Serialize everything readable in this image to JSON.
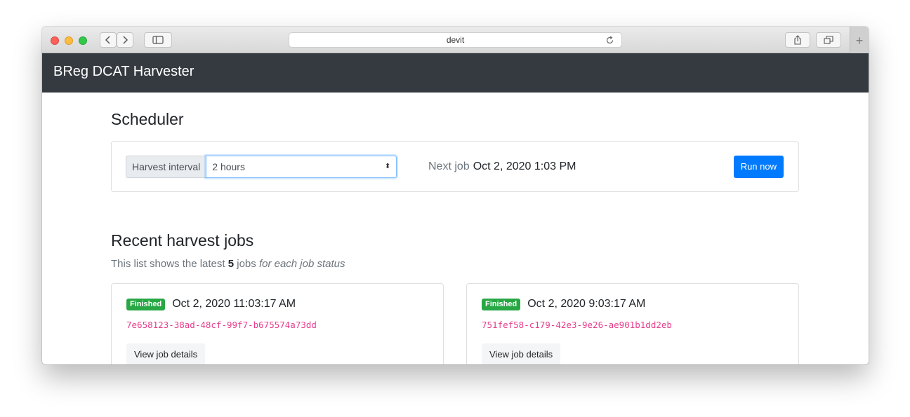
{
  "browser": {
    "address": "devit",
    "icons": {
      "back": "chevron-left-icon",
      "forward": "chevron-right-icon",
      "sidebar": "sidebar-icon",
      "reload": "reload-icon",
      "share": "share-icon",
      "tabs": "tabs-overview-icon",
      "new_tab": "plus-icon"
    },
    "new_tab_glyph": "+"
  },
  "navbar": {
    "brand": "BReg DCAT Harvester",
    "background": "#343a40"
  },
  "scheduler": {
    "title": "Scheduler",
    "interval_label": "Harvest interval",
    "interval_value": "2 hours",
    "select_arrows": "⬍",
    "next_job_label": "Next job",
    "next_job_value": "Oct 2, 2020 1:03 PM",
    "run_now_label": "Run now",
    "accent": "#007bff"
  },
  "recent_jobs": {
    "title": "Recent harvest jobs",
    "lead_prefix": "This list shows the latest ",
    "lead_count": "5",
    "lead_middle": " jobs ",
    "lead_emphasis": "for each job status",
    "jobs": [
      {
        "status": "Finished",
        "time": "Oct 2, 2020 11:03:17 AM",
        "id": "7e658123-38ad-48cf-99f7-b675574a73dd",
        "details_label": "View job details"
      },
      {
        "status": "Finished",
        "time": "Oct 2, 2020 9:03:17 AM",
        "id": "751fef58-c179-42e3-9e26-ae901b1dd2eb",
        "details_label": "View job details"
      }
    ],
    "status_color": "#28a745",
    "id_color": "#e83e8c"
  }
}
